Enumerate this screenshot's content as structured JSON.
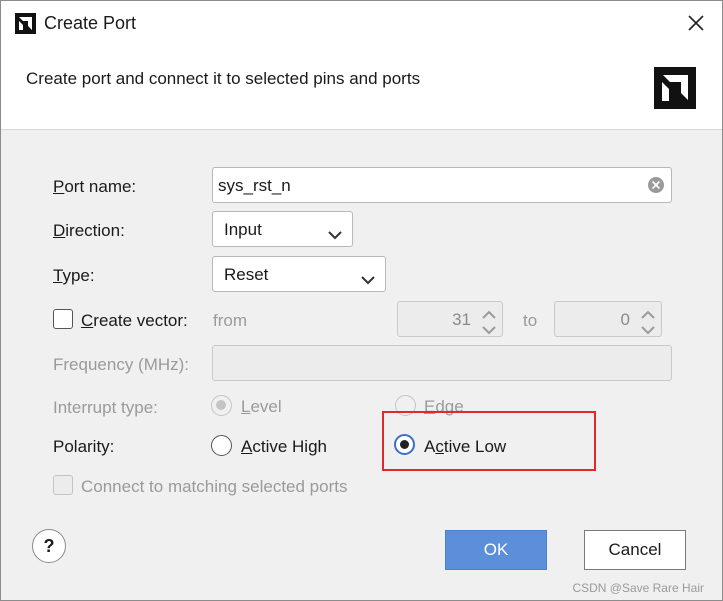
{
  "window": {
    "title": "Create Port"
  },
  "header": {
    "description": "Create port and connect it to selected pins and ports"
  },
  "form": {
    "port_name": {
      "label_prefix": "P",
      "label_rest": "ort name:",
      "value": "sys_rst_n"
    },
    "direction": {
      "label_prefix": "D",
      "label_rest": "irection:",
      "value": "Input"
    },
    "type": {
      "label_prefix": "T",
      "label_rest": "ype:",
      "value": "Reset"
    },
    "create_vector": {
      "label_prefix": "C",
      "label_rest": "reate vector:",
      "checked": false,
      "from_label": "from",
      "from_value": "31",
      "to_label": "to",
      "to_value": "0"
    },
    "frequency": {
      "label": "Frequency (MHz):",
      "value": ""
    },
    "interrupt_type": {
      "label": "Interrupt type:",
      "options": [
        {
          "label_prefix": "L",
          "label_rest": "evel",
          "selected": true
        },
        {
          "label_prefix": "E",
          "label_rest": "dge",
          "selected": false
        }
      ]
    },
    "polarity": {
      "label": "Polarity:",
      "options": [
        {
          "label_prefix": "A",
          "label_rest": "ctive High",
          "selected": false
        },
        {
          "label_prefix": "A",
          "label_rest": "c",
          "label_rest2": "tive Low",
          "selected": true
        }
      ]
    },
    "connect_matching": {
      "label": "Connect to matching selected ports",
      "checked": false
    }
  },
  "buttons": {
    "help": "?",
    "ok": "OK",
    "cancel": "Cancel"
  },
  "watermark": "CSDN @Save Rare Hair",
  "colors": {
    "accent": "#5b8fd9",
    "highlight": "#e02a2a",
    "selected_ring": "#3c6fc8"
  },
  "icons": [
    "app-logo-icon",
    "close-icon",
    "amd-logo-icon",
    "clear-icon",
    "chevron-down-icon",
    "spin-up-icon",
    "spin-down-icon"
  ]
}
